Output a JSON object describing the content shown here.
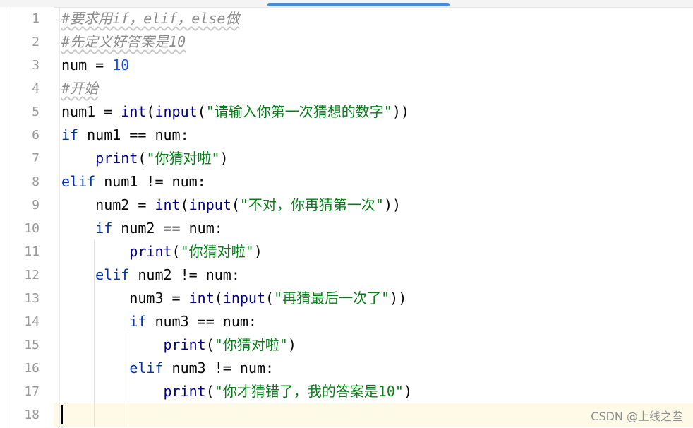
{
  "editor": {
    "lines": [
      {
        "n": "1",
        "tokens": [
          {
            "t": "#要求用if，elif，else做",
            "c": "cm"
          }
        ]
      },
      {
        "n": "2",
        "tokens": [
          {
            "t": "#先定义好答案是10",
            "c": "cm"
          }
        ]
      },
      {
        "n": "3",
        "tokens": [
          {
            "t": "num = "
          },
          {
            "t": "10",
            "c": "num"
          }
        ]
      },
      {
        "n": "4",
        "tokens": [
          {
            "t": "#开始",
            "c": "cm"
          }
        ]
      },
      {
        "n": "5",
        "tokens": [
          {
            "t": "num1 = "
          },
          {
            "t": "int",
            "c": "fn"
          },
          {
            "t": "("
          },
          {
            "t": "input",
            "c": "fn"
          },
          {
            "t": "("
          },
          {
            "t": "\"请输入你第一次猜想的数字\"",
            "c": "str"
          },
          {
            "t": "))"
          }
        ]
      },
      {
        "n": "6",
        "tokens": [
          {
            "t": "if",
            "c": "kw"
          },
          {
            "t": " num1 == num:"
          }
        ]
      },
      {
        "n": "7",
        "tokens": [
          {
            "t": "    "
          },
          {
            "t": "print",
            "c": "fn"
          },
          {
            "t": "("
          },
          {
            "t": "\"你猜对啦\"",
            "c": "str"
          },
          {
            "t": ")"
          }
        ]
      },
      {
        "n": "8",
        "tokens": [
          {
            "t": "elif",
            "c": "kw"
          },
          {
            "t": " num1 != num:"
          }
        ]
      },
      {
        "n": "9",
        "tokens": [
          {
            "t": "    num2 = "
          },
          {
            "t": "int",
            "c": "fn"
          },
          {
            "t": "("
          },
          {
            "t": "input",
            "c": "fn"
          },
          {
            "t": "("
          },
          {
            "t": "\"不对，你再猜第一次\"",
            "c": "str"
          },
          {
            "t": "))"
          }
        ]
      },
      {
        "n": "10",
        "tokens": [
          {
            "t": "    "
          },
          {
            "t": "if",
            "c": "kw"
          },
          {
            "t": " num2 == num:"
          }
        ]
      },
      {
        "n": "11",
        "tokens": [
          {
            "t": "        "
          },
          {
            "t": "print",
            "c": "fn"
          },
          {
            "t": "("
          },
          {
            "t": "\"你猜对啦\"",
            "c": "str"
          },
          {
            "t": ")"
          }
        ]
      },
      {
        "n": "12",
        "tokens": [
          {
            "t": "    "
          },
          {
            "t": "elif",
            "c": "kw"
          },
          {
            "t": " num2 != num:"
          }
        ]
      },
      {
        "n": "13",
        "tokens": [
          {
            "t": "        num3 = "
          },
          {
            "t": "int",
            "c": "fn"
          },
          {
            "t": "("
          },
          {
            "t": "input",
            "c": "fn"
          },
          {
            "t": "("
          },
          {
            "t": "\"再猜最后一次了\"",
            "c": "str"
          },
          {
            "t": "))"
          }
        ]
      },
      {
        "n": "14",
        "tokens": [
          {
            "t": "        "
          },
          {
            "t": "if",
            "c": "kw"
          },
          {
            "t": " num3 == num:"
          }
        ]
      },
      {
        "n": "15",
        "tokens": [
          {
            "t": "            "
          },
          {
            "t": "print",
            "c": "fn"
          },
          {
            "t": "("
          },
          {
            "t": "\"你猜对啦\"",
            "c": "str"
          },
          {
            "t": ")"
          }
        ]
      },
      {
        "n": "16",
        "tokens": [
          {
            "t": "        "
          },
          {
            "t": "elif",
            "c": "kw"
          },
          {
            "t": " num3 != num:"
          }
        ]
      },
      {
        "n": "17",
        "tokens": [
          {
            "t": "            "
          },
          {
            "t": "print",
            "c": "fn"
          },
          {
            "t": "("
          },
          {
            "t": "\"你才猜错了，我的答案是10\"",
            "c": "str"
          },
          {
            "t": ")"
          }
        ]
      },
      {
        "n": "18",
        "tokens": []
      }
    ]
  },
  "colors": {
    "keyword": "#0033b3",
    "builtin": "#000080",
    "number": "#1750eb",
    "string": "#067d17",
    "comment": "#8c8c8c",
    "current_line": "#fdfbe8",
    "scroll_thumb": "#4a89d8"
  },
  "watermark": "CSDN @上线之叁"
}
